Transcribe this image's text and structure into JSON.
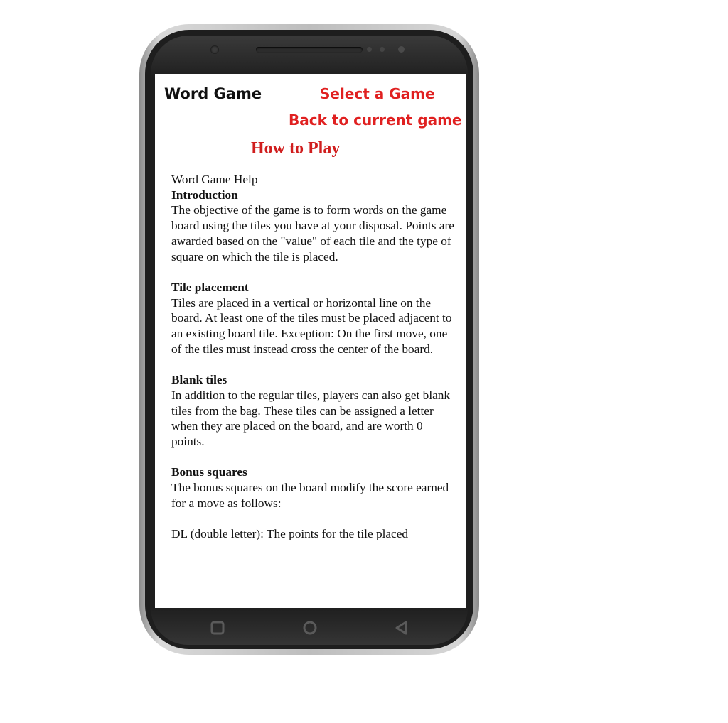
{
  "app": {
    "title": "Word Game"
  },
  "header": {
    "select_game_label": "Select a Game",
    "back_to_game_label": "Back to current game"
  },
  "page": {
    "heading": "How to Play"
  },
  "help": {
    "title": "Word Game Help",
    "sections": [
      {
        "heading": "Introduction",
        "body": "The objective of the game is to form words on the game board using the tiles you have at your disposal. Points are awarded based on the \"value\" of each tile and the type of square on which the tile is placed."
      },
      {
        "heading": "Tile placement",
        "body": "Tiles are placed in a vertical or horizontal line on the board. At least one of the tiles must be placed adjacent to an existing board tile. Exception: On the first move, one of the tiles must instead cross the center of the board."
      },
      {
        "heading": "Blank tiles",
        "body": "In addition to the regular tiles, players can also get blank tiles from the bag. These tiles can be assigned a letter when they are placed on the board, and are worth 0 points."
      },
      {
        "heading": "Bonus squares",
        "body": "The bonus squares on the board modify the score earned for a move as follows:"
      }
    ],
    "trailing_line": "DL (double letter): The points for the tile placed"
  },
  "icons": {
    "recent_apps": "square-icon",
    "home": "circle-icon",
    "back": "triangle-back-icon"
  },
  "colors": {
    "link": "#e02020",
    "heading": "#d01e1e",
    "phone_body": "#1e1e1e"
  }
}
